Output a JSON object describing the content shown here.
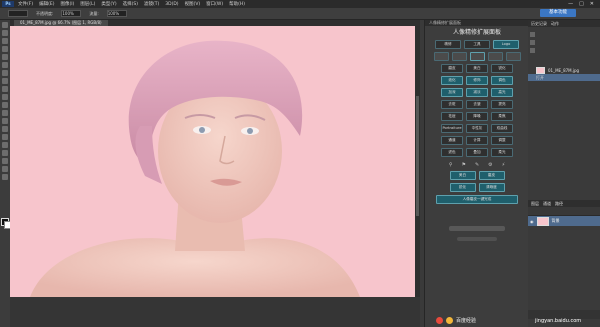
{
  "app": {
    "logo": "Ps"
  },
  "menu": [
    "文件(F)",
    "编辑(E)",
    "图像(I)",
    "图层(L)",
    "类型(Y)",
    "选择(S)",
    "滤镜(T)",
    "3D(D)",
    "视图(V)",
    "窗口(W)",
    "帮助(H)"
  ],
  "window_controls": [
    "—",
    "□",
    "✕"
  ],
  "options_bar": {
    "labels": [
      "不透明度:",
      "流量:"
    ],
    "values": [
      "100%",
      "100%"
    ]
  },
  "essentials_button": "基本功能",
  "document_tab": "01_ME_87M.jpg @ 66.7% (图层 1, RGB/8)",
  "plugin": {
    "header": "人像精修扩展面板",
    "title": "人像精修扩展面板",
    "tabs": [
      "精修",
      "工具",
      "Logo"
    ],
    "rows": [
      [
        "磨皮",
        "美白",
        "锐化"
      ],
      [
        "液化",
        "修饰",
        "调色"
      ],
      [
        "加深",
        "减淡",
        "高光"
      ],
      [
        "去斑",
        "去皱",
        "提亮"
      ],
      [
        "祛痘",
        "降噪",
        "柔焦"
      ],
      [
        "Portraiture",
        "中性灰",
        "双曲线"
      ],
      [
        "通道",
        "计算",
        "调整"
      ],
      [
        "滤色",
        "叠加",
        "柔光"
      ]
    ],
    "bottom_rows": [
      [
        "美白",
        "磨皮"
      ],
      [
        "锐化",
        "清晰度"
      ]
    ],
    "wide_button": "人像磨皮一键完成"
  },
  "right_panel": {
    "tabs_top": [
      "历史记录",
      "动作"
    ],
    "history_items": [
      {
        "label": "01_ME_87M.jpg"
      },
      {
        "label": "打开"
      }
    ],
    "layers_tabs": [
      "图层",
      "通道",
      "路径"
    ],
    "layer_name": "背景"
  },
  "watermark": {
    "brand": "百度经验",
    "site": "jingyan.baidu.com"
  },
  "colors": {
    "canvas_bg": "#f7c5cc",
    "ui_dark": "#3a3a3a",
    "accent": "#3b77c4"
  }
}
